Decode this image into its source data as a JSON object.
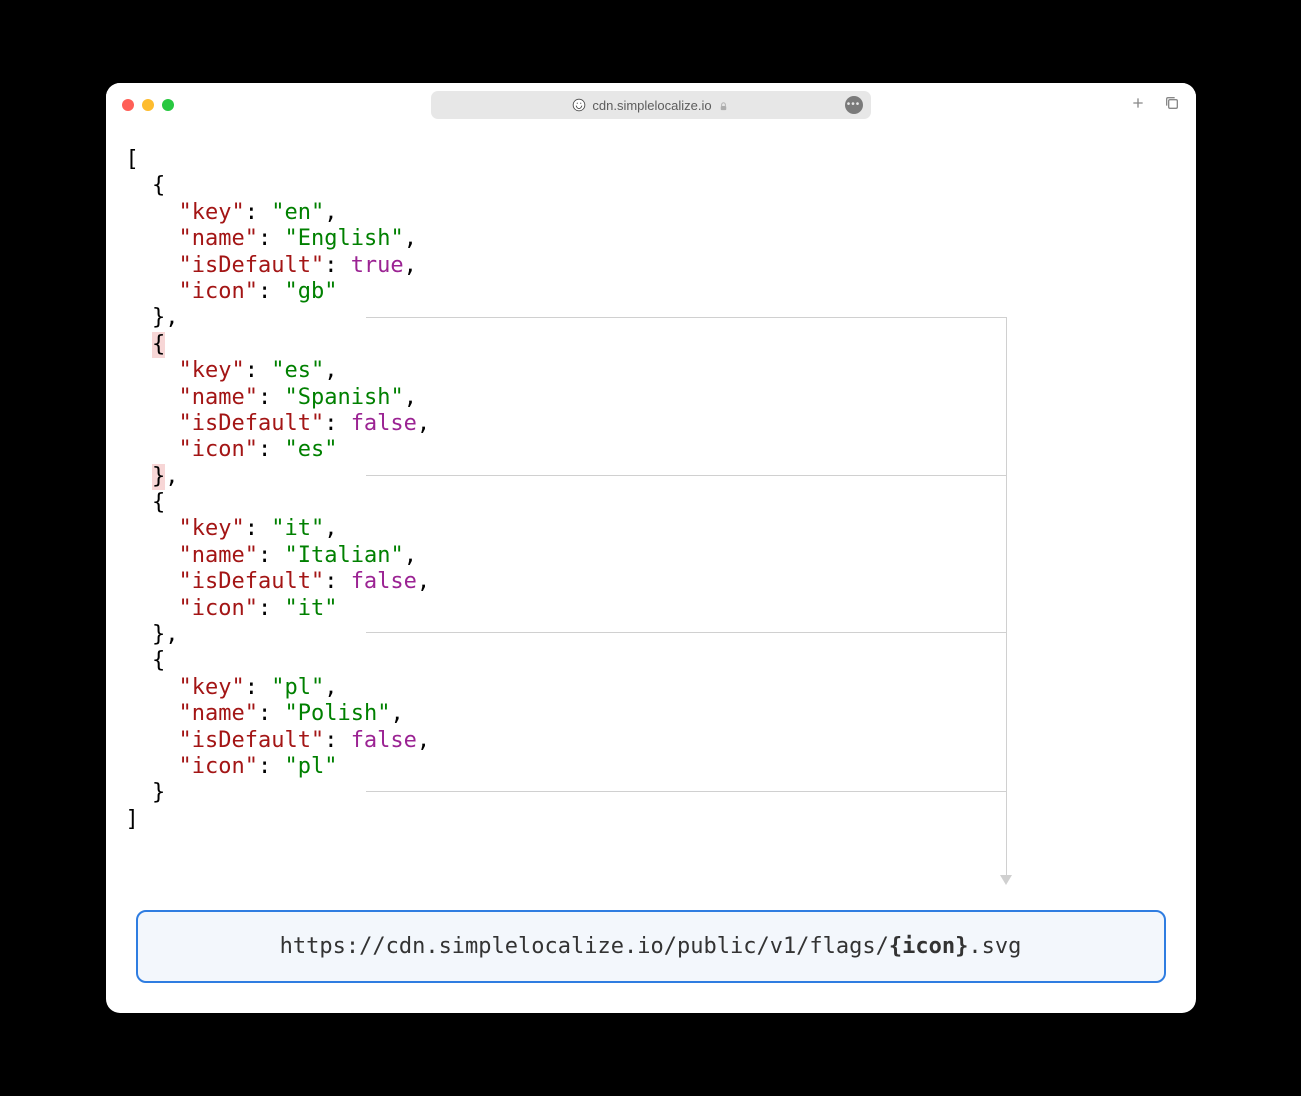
{
  "titlebar": {
    "url": "cdn.simplelocalize.io"
  },
  "json": {
    "entries": [
      {
        "key": "en",
        "name": "English",
        "isDefault": "true",
        "icon": "gb"
      },
      {
        "key": "es",
        "name": "Spanish",
        "isDefault": "false",
        "icon": "es"
      },
      {
        "key": "it",
        "name": "Italian",
        "isDefault": "false",
        "icon": "it"
      },
      {
        "key": "pl",
        "name": "Polish",
        "isDefault": "false",
        "icon": "pl"
      }
    ],
    "k_key": "\"key\"",
    "k_name": "\"name\"",
    "k_isDefault": "\"isDefault\"",
    "k_icon": "\"icon\""
  },
  "urlbox": {
    "prefix": "https://cdn.simplelocalize.io/public/v1/flags/",
    "placeholder": "{icon}",
    "suffix": ".svg"
  },
  "punct": {
    "lbracket": "[",
    "rbracket": "]",
    "lbrace": "{",
    "rbrace": "}",
    "rbrace_comma": "},",
    "comma": ",",
    "colon": ": ",
    "q": "\""
  }
}
